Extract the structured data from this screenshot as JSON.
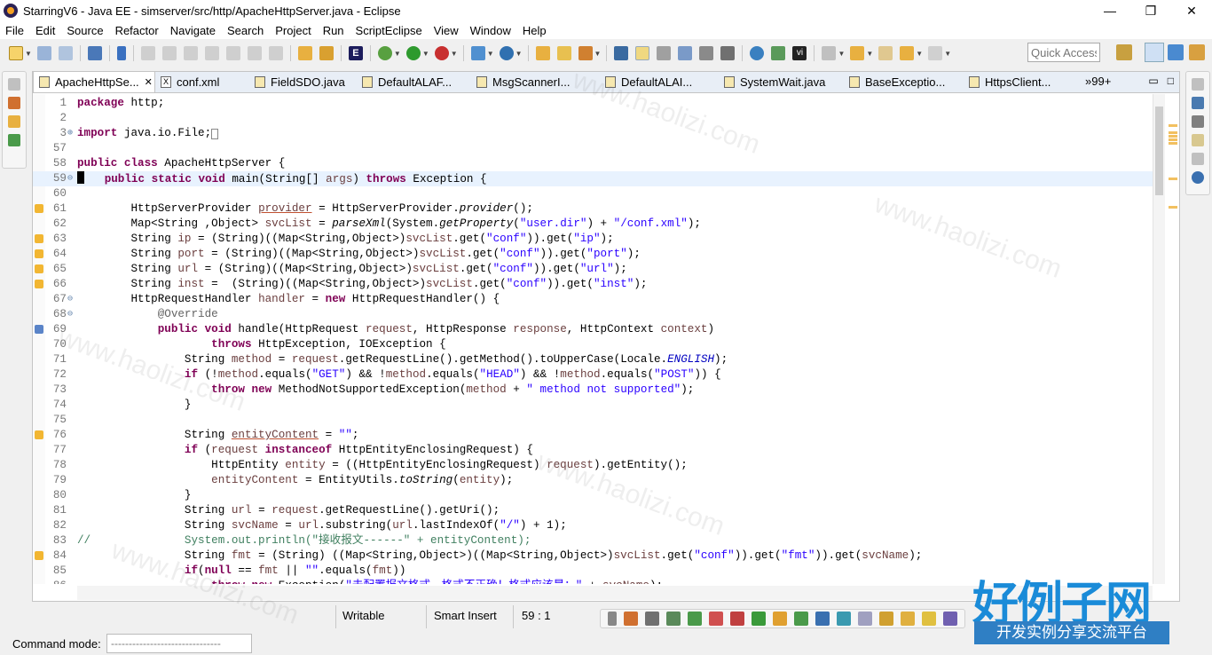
{
  "window": {
    "title": "StarringV6 - Java EE - simserver/src/http/ApacheHttpServer.java - Eclipse",
    "minimize": "—",
    "maximize": "❐",
    "close": "✕"
  },
  "menu": [
    "File",
    "Edit",
    "Source",
    "Refactor",
    "Navigate",
    "Search",
    "Project",
    "Run",
    "ScriptEclipse",
    "View",
    "Window",
    "Help"
  ],
  "quick_access": {
    "placeholder": "Quick Access"
  },
  "tabs": [
    {
      "label": "ApacheHttpSe...",
      "icon": "java-file-icon",
      "active": true
    },
    {
      "label": "conf.xml",
      "icon": "xml-file-icon"
    },
    {
      "label": "FieldSDO.java",
      "icon": "java-file-icon"
    },
    {
      "label": "DefaultALAF...",
      "icon": "java-file-icon"
    },
    {
      "label": "MsgScannerI...",
      "icon": "java-file-icon"
    },
    {
      "label": "DefaultALAI...",
      "icon": "java-file-icon"
    },
    {
      "label": "SystemWait.java",
      "icon": "java-file-icon"
    },
    {
      "label": "BaseExceptio...",
      "icon": "java-file-icon"
    },
    {
      "label": "HttpsClient...",
      "icon": "java-file-icon"
    }
  ],
  "tab_overflow": "»99+",
  "code_lines": [
    {
      "n": "1",
      "fold": "",
      "mark": "",
      "html": "<span class='kw'>package</span> http;"
    },
    {
      "n": "2",
      "fold": "",
      "mark": "",
      "html": ""
    },
    {
      "n": "3",
      "fold": "⊕",
      "mark": "",
      "html": "<span class='kw'>import</span> java.io.File;<span style='border:1px solid #888;font-size:9px'>&nbsp;</span>"
    },
    {
      "n": "57",
      "fold": "",
      "mark": "",
      "html": ""
    },
    {
      "n": "58",
      "fold": "",
      "mark": "",
      "html": "<span class='kw'>public</span> <span class='kw'>class</span> ApacheHttpServer {"
    },
    {
      "n": "59",
      "fold": "⊖",
      "mark": "",
      "cur": true,
      "html": "<span class='caret'></span>   <span class='kw'>public</span> <span class='kw'>static</span> <span class='kw'>void</span> main(String[] <span class='var'>args</span>) <span class='kw'>throws</span> Exception {"
    },
    {
      "n": "60",
      "fold": "",
      "mark": "",
      "html": ""
    },
    {
      "n": "61",
      "fold": "",
      "mark": "w",
      "html": "        HttpServerProvider <span class='var ovv'>provider</span> = HttpServerProvider.<span class='it'>provider</span>();"
    },
    {
      "n": "62",
      "fold": "",
      "mark": "",
      "html": "        Map&lt;String ,Object&gt; <span class='var'>svcList</span> = <span class='it'>parseXml</span>(System.<span class='it'>getProperty</span>(<span class='str'>\"user.dir\"</span>) + <span class='str'>\"/conf.xml\"</span>);"
    },
    {
      "n": "63",
      "fold": "",
      "mark": "w",
      "html": "        String <span class='var'>ip</span> = (String)((Map&lt;String,Object&gt;)<span class='var'>svcList</span>.get(<span class='str'>\"conf\"</span>)).get(<span class='str'>\"ip\"</span>);"
    },
    {
      "n": "64",
      "fold": "",
      "mark": "w",
      "html": "        String <span class='var'>port</span> = (String)((Map&lt;String,Object&gt;)<span class='var'>svcList</span>.get(<span class='str'>\"conf\"</span>)).get(<span class='str'>\"port\"</span>);"
    },
    {
      "n": "65",
      "fold": "",
      "mark": "w",
      "html": "        String <span class='var'>url</span> = (String)((Map&lt;String,Object&gt;)<span class='var'>svcList</span>.get(<span class='str'>\"conf\"</span>)).get(<span class='str'>\"url\"</span>);"
    },
    {
      "n": "66",
      "fold": "",
      "mark": "w",
      "html": "        String <span class='var'>inst</span> =  (String)((Map&lt;String,Object&gt;)<span class='var'>svcList</span>.get(<span class='str'>\"conf\"</span>)).get(<span class='str'>\"inst\"</span>);"
    },
    {
      "n": "67",
      "fold": "⊖",
      "mark": "",
      "html": "        HttpRequestHandler <span class='var'>handler</span> = <span class='kw'>new</span> HttpRequestHandler() {"
    },
    {
      "n": "68",
      "fold": "⊖",
      "mark": "",
      "html": "            <span class='ann'>@Override</span>"
    },
    {
      "n": "69",
      "fold": "",
      "mark": "o",
      "html": "            <span class='kw'>public</span> <span class='kw'>void</span> handle(HttpRequest <span class='var'>request</span>, HttpResponse <span class='var'>response</span>, HttpContext <span class='var'>context</span>)"
    },
    {
      "n": "70",
      "fold": "",
      "mark": "",
      "html": "                    <span class='kw'>throws</span> HttpException, IOException {"
    },
    {
      "n": "71",
      "fold": "",
      "mark": "",
      "html": "                String <span class='var'>method</span> = <span class='var'>request</span>.getRequestLine().getMethod().toUpperCase(Locale.<span class='fld it'>ENGLISH</span>);"
    },
    {
      "n": "72",
      "fold": "",
      "mark": "",
      "html": "                <span class='kw'>if</span> (!<span class='var'>method</span>.equals(<span class='str'>\"GET\"</span>) &amp;&amp; !<span class='var'>method</span>.equals(<span class='str'>\"HEAD\"</span>) &amp;&amp; !<span class='var'>method</span>.equals(<span class='str'>\"POST\"</span>)) {"
    },
    {
      "n": "73",
      "fold": "",
      "mark": "",
      "html": "                    <span class='kw'>throw</span> <span class='kw'>new</span> MethodNotSupportedException(<span class='var'>method</span> + <span class='str'>\" method not supported\"</span>);"
    },
    {
      "n": "74",
      "fold": "",
      "mark": "",
      "html": "                }"
    },
    {
      "n": "75",
      "fold": "",
      "mark": "",
      "html": ""
    },
    {
      "n": "76",
      "fold": "",
      "mark": "w",
      "html": "                String <span class='var ovv'>entityContent</span> = <span class='str'>\"\"</span>;"
    },
    {
      "n": "77",
      "fold": "",
      "mark": "",
      "html": "                <span class='kw'>if</span> (<span class='var'>request</span> <span class='kw'>instanceof</span> HttpEntityEnclosingRequest) {"
    },
    {
      "n": "78",
      "fold": "",
      "mark": "",
      "html": "                    HttpEntity <span class='var'>entity</span> = ((HttpEntityEnclosingRequest) <span class='var'>request</span>).getEntity();"
    },
    {
      "n": "79",
      "fold": "",
      "mark": "",
      "html": "                    <span class='var'>entityContent</span> = EntityUtils.<span class='it'>toString</span>(<span class='var'>entity</span>);"
    },
    {
      "n": "80",
      "fold": "",
      "mark": "",
      "html": "                }"
    },
    {
      "n": "81",
      "fold": "",
      "mark": "",
      "html": "                String <span class='var'>url</span> = <span class='var'>request</span>.getRequestLine().getUri();"
    },
    {
      "n": "82",
      "fold": "",
      "mark": "",
      "html": "                String <span class='var'>svcName</span> = <span class='var'>url</span>.substring(<span class='var'>url</span>.lastIndexOf(<span class='str'>\"/\"</span>) + 1);"
    },
    {
      "n": "83",
      "fold": "",
      "mark": "",
      "html": "<span class='cmt'>//              System.out.println(\"接收报文------\" + entityContent);</span>"
    },
    {
      "n": "84",
      "fold": "",
      "mark": "w",
      "html": "                String <span class='var'>fmt</span> = (String) ((Map&lt;String,Object&gt;)((Map&lt;String,Object&gt;)<span class='var'>svcList</span>.get(<span class='str'>\"conf\"</span>)).get(<span class='str'>\"fmt\"</span>)).get(<span class='var'>svcName</span>);"
    },
    {
      "n": "85",
      "fold": "",
      "mark": "",
      "html": "                <span class='kw'>if</span>(<span class='kw'>null</span> == <span class='var'>fmt</span> || <span class='str'>\"\"</span>.equals(<span class='var'>fmt</span>))"
    },
    {
      "n": "86",
      "fold": "",
      "mark": "",
      "html": "                    <span class='kw'>throw</span> <span class='kw'>new</span> Exception(<span class='str'>\"未配置报文格式，格式不正确！格式应该是：\"</span> + <span class='var'>svcName</span>);"
    }
  ],
  "status": {
    "writable": "Writable",
    "insert_mode": "Smart Insert",
    "position": "59 : 1"
  },
  "command": {
    "label": "Command mode:",
    "value": "-------------------------------"
  },
  "brand": {
    "big": "好例子网",
    "small": "开发实例分享交流平台"
  },
  "watermark": "www.haolizi.com",
  "colors": {
    "keyword": "#7f0055",
    "string": "#2a00ff",
    "comment": "#3f7f5f",
    "current_line": "#e8f2fe",
    "brand_blue": "#1a8bd8"
  }
}
